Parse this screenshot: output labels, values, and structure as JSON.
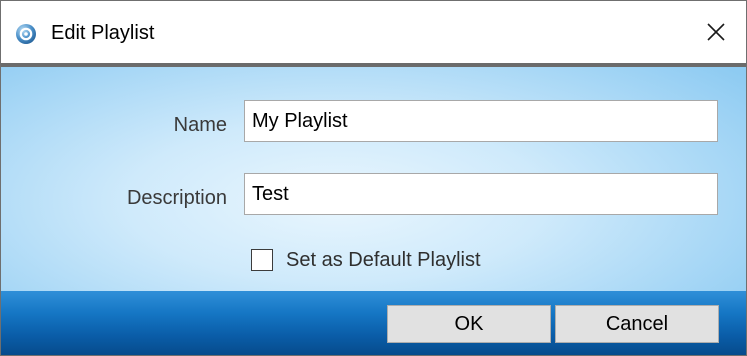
{
  "window": {
    "title": "Edit Playlist"
  },
  "icons": {
    "app": "app-logo-icon",
    "close": "close-icon"
  },
  "form": {
    "name_label": "Name",
    "name_value": "My Playlist",
    "description_label": "Description",
    "description_value": "Test",
    "default_checkbox_label": "Set as Default Playlist",
    "default_checked": false
  },
  "buttons": {
    "ok_label": "OK",
    "cancel_label": "Cancel"
  },
  "colors": {
    "footer_accent": "#0a5da8",
    "content_background": "#cfeafb"
  }
}
